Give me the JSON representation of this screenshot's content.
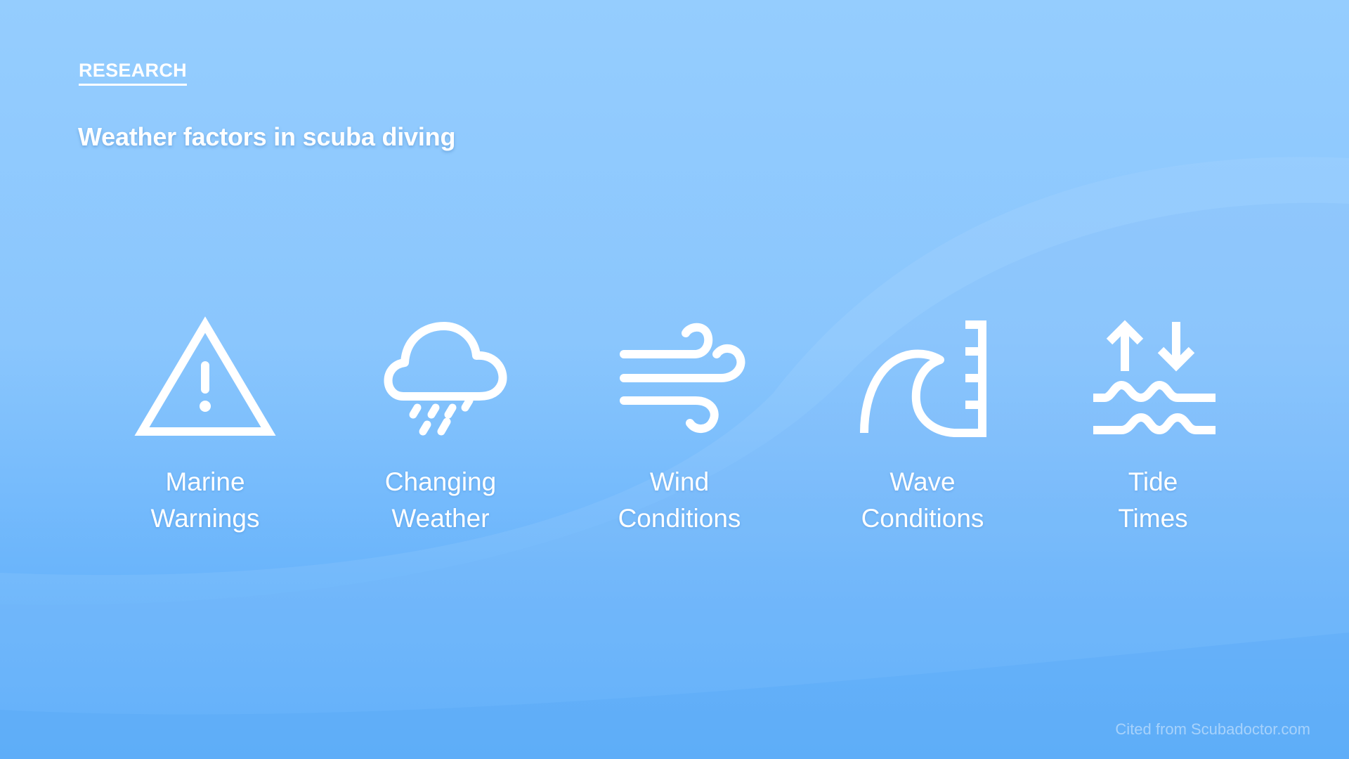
{
  "header": {
    "section_label": "RESEARCH",
    "title": "Weather factors in scuba diving"
  },
  "factors": [
    {
      "icon": "warning-triangle-icon",
      "line1": "Marine",
      "line2": "Warnings"
    },
    {
      "icon": "rain-cloud-icon",
      "line1": "Changing",
      "line2": "Weather"
    },
    {
      "icon": "wind-icon",
      "line1": "Wind",
      "line2": "Conditions"
    },
    {
      "icon": "wave-height-icon",
      "line1": "Wave",
      "line2": "Conditions"
    },
    {
      "icon": "tide-icon",
      "line1": "Tide",
      "line2": "Times"
    }
  ],
  "footer": {
    "citation": "Cited from Scubadoctor.com"
  },
  "colors": {
    "background_top": "#95cdfe",
    "background_bottom": "#55acf9",
    "foreground": "#ffffff"
  }
}
